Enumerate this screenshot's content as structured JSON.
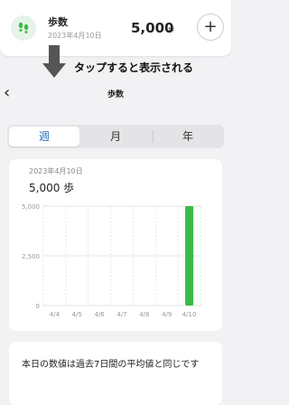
{
  "top_card": {
    "title": "歩数",
    "date": "2023年4月10日",
    "value": "5,000",
    "unit": "歩",
    "add_label": "+"
  },
  "annotation": "タップすると表示される",
  "header": {
    "title": "歩数"
  },
  "segments": [
    {
      "label": "週",
      "active": true
    },
    {
      "label": "月",
      "active": false
    },
    {
      "label": "年",
      "active": false
    }
  ],
  "chart_header": {
    "date": "2023年4月10日",
    "value": "5,000 歩"
  },
  "colors": {
    "accent": "#2a6fb8",
    "bar": "#3cba45",
    "icon_bg": "#e5f3e9"
  },
  "chart_data": {
    "type": "bar",
    "categories": [
      "4/4",
      "4/5",
      "4/6",
      "4/7",
      "4/8",
      "4/9",
      "4/10"
    ],
    "values": [
      0,
      0,
      0,
      0,
      0,
      0,
      5000
    ],
    "yticks": [
      "5,000",
      "2,500",
      "0"
    ],
    "ylim": [
      0,
      5000
    ],
    "grid": true
  },
  "summary": {
    "text": "本日の数値は過去7日間の平均値と同じです"
  }
}
